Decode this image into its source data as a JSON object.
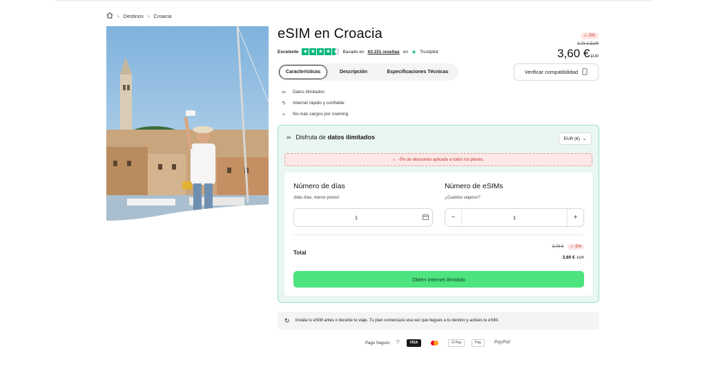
{
  "breadcrumb": {
    "items": [
      "Destinos",
      "Croacia"
    ]
  },
  "product": {
    "title": "eSIM en Croacia",
    "rating_label": "Excelente",
    "reviews_prefix": "Basado en",
    "reviews_count": "63.151 reseñas",
    "reviews_suffix": "en",
    "trustpilot": "Trustpilot"
  },
  "price": {
    "discount_badge": "-5%",
    "old": "3,79 €  EUR",
    "current": "3,60 €",
    "currency": "EUR"
  },
  "tabs": [
    {
      "label": "Características",
      "active": true
    },
    {
      "label": "Descripción",
      "active": false
    },
    {
      "label": "Especificaciones Técnicas",
      "active": false
    }
  ],
  "verify_button": "Verificar compatibilidad",
  "features": [
    {
      "icon": "infinity-icon",
      "label": "Datos ilimitados"
    },
    {
      "icon": "lightning-icon",
      "label": "Internet rápido y confiable"
    },
    {
      "icon": "no-roaming-icon",
      "label": "No más cargos por roaming"
    }
  ],
  "plan": {
    "header_prefix": "Disfruta de",
    "header_bold": "datos ilimitados",
    "currency_select": "EUR (€)",
    "discount_banner": "-5% de descuento aplicado a todos los planes.",
    "days_title": "Número de días",
    "days_sub": "¡Más días, menor precio!",
    "days_value": "1",
    "esims_title": "Número de eSIMs",
    "esims_sub": "¿Cuántos viajeros?",
    "esims_value": "1",
    "total_label": "Total",
    "total_old": "3,79 €",
    "total_badge": "-5%",
    "total_new": "3,60 €",
    "total_currency": "EUR",
    "cta": "Obtén internet ilimitado"
  },
  "install_note": "Instala tu eSIM antes o durante tu viaje. Tu plan comenzará una vez que llegues a tu destino y actives tu eSIM.",
  "payment": {
    "label": "Pago Seguro",
    "logos": [
      "VISA",
      "G Pay",
      "Pay",
      "PayPal"
    ]
  },
  "colors": {
    "accent_green": "#4de37f",
    "card_bg": "#e9f6f1",
    "discount_red": "#c0392b"
  }
}
